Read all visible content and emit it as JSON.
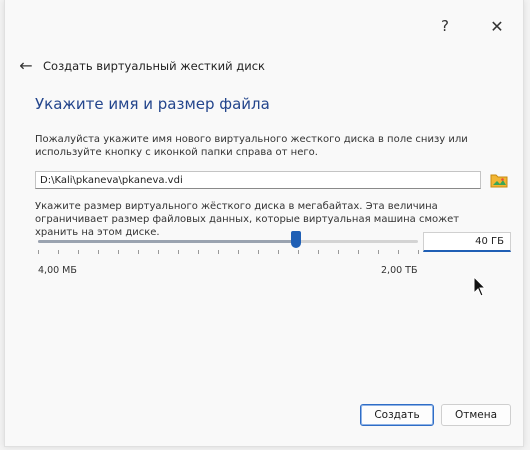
{
  "titlebar": {
    "help_glyph": "?",
    "close_glyph": "✕"
  },
  "header": {
    "back_glyph": "←",
    "dialog_title": "Создать виртуальный жесткий диск"
  },
  "main": {
    "section_title": "Укажите имя и размер файла",
    "file_description": "Пожалуйста укажите имя нового виртуального жесткого диска в поле снизу или используйте кнопку с иконкой папки справа от него.",
    "file_path": "D:\\Kali\\pkaneva\\pkaneva.vdi",
    "size_description": "Укажите размер виртуального жёсткого диска в мегабайтах. Эта величина ограничивает размер файловых данных, которые виртуальная машина сможет хранить на этом диске.",
    "size_value": "40 ГБ",
    "size_slider_fraction": 0.68,
    "scale_min": "4,00 МБ",
    "scale_max": "2,00 ТБ",
    "tick_count": 20
  },
  "footer": {
    "create_label": "Создать",
    "cancel_label": "Отмена"
  },
  "icons": {
    "back": "arrow-left-icon",
    "folder": "folder-icon",
    "help": "help-icon",
    "close": "close-icon"
  },
  "colors": {
    "accent": "#1f5fb5",
    "section_title": "#23458c"
  }
}
